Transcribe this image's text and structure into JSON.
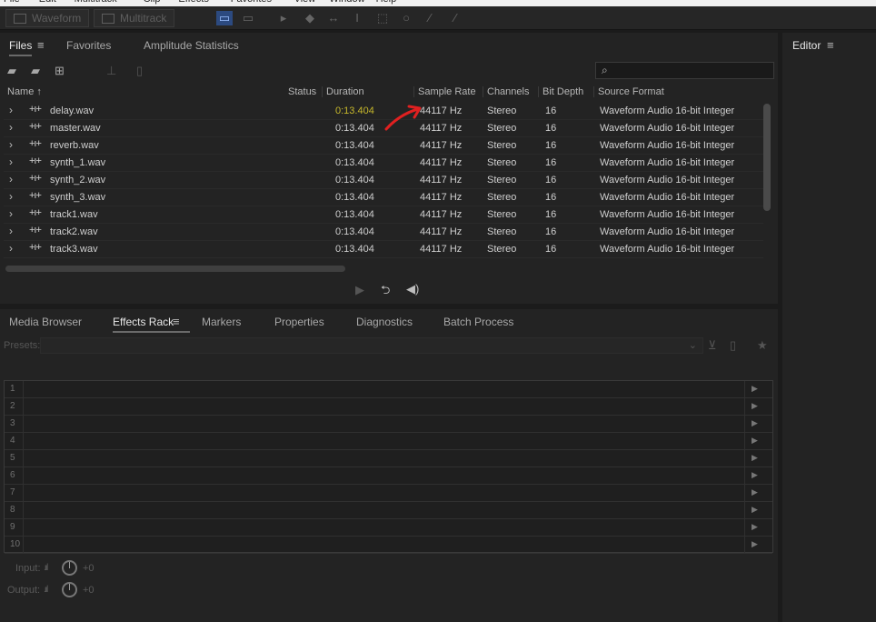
{
  "menu": [
    "File",
    "Edit",
    "Multitrack",
    "Clip",
    "Effects",
    "Favorites",
    "View",
    "Window",
    "Help"
  ],
  "toolbar": {
    "waveform_label": "Waveform",
    "multitrack_label": "Multitrack"
  },
  "files_panel": {
    "tabs": [
      {
        "label": "Files"
      },
      {
        "label": "Favorites"
      },
      {
        "label": "Amplitude Statistics"
      }
    ],
    "search_placeholder": "",
    "columns": [
      "Name",
      "Status",
      "Duration",
      "Sample Rate",
      "Channels",
      "Bit Depth",
      "Source Format"
    ],
    "rows": [
      {
        "name": "delay.wav",
        "status": "",
        "duration": "0:13.404",
        "sample_rate": "44117 Hz",
        "channels": "Stereo",
        "bit_depth": "16",
        "source_format": "Waveform Audio 16-bit Integer"
      },
      {
        "name": "master.wav",
        "status": "",
        "duration": "0:13.404",
        "sample_rate": "44117 Hz",
        "channels": "Stereo",
        "bit_depth": "16",
        "source_format": "Waveform Audio 16-bit Integer"
      },
      {
        "name": "reverb.wav",
        "status": "",
        "duration": "0:13.404",
        "sample_rate": "44117 Hz",
        "channels": "Stereo",
        "bit_depth": "16",
        "source_format": "Waveform Audio 16-bit Integer"
      },
      {
        "name": "synth_1.wav",
        "status": "",
        "duration": "0:13.404",
        "sample_rate": "44117 Hz",
        "channels": "Stereo",
        "bit_depth": "16",
        "source_format": "Waveform Audio 16-bit Integer"
      },
      {
        "name": "synth_2.wav",
        "status": "",
        "duration": "0:13.404",
        "sample_rate": "44117 Hz",
        "channels": "Stereo",
        "bit_depth": "16",
        "source_format": "Waveform Audio 16-bit Integer"
      },
      {
        "name": "synth_3.wav",
        "status": "",
        "duration": "0:13.404",
        "sample_rate": "44117 Hz",
        "channels": "Stereo",
        "bit_depth": "16",
        "source_format": "Waveform Audio 16-bit Integer"
      },
      {
        "name": "track1.wav",
        "status": "",
        "duration": "0:13.404",
        "sample_rate": "44117 Hz",
        "channels": "Stereo",
        "bit_depth": "16",
        "source_format": "Waveform Audio 16-bit Integer"
      },
      {
        "name": "track2.wav",
        "status": "",
        "duration": "0:13.404",
        "sample_rate": "44117 Hz",
        "channels": "Stereo",
        "bit_depth": "16",
        "source_format": "Waveform Audio 16-bit Integer"
      },
      {
        "name": "track3.wav",
        "status": "",
        "duration": "0:13.404",
        "sample_rate": "44117 Hz",
        "channels": "Stereo",
        "bit_depth": "16",
        "source_format": "Waveform Audio 16-bit Integer"
      }
    ]
  },
  "editor_panel": {
    "title": "Editor"
  },
  "effects_panel": {
    "tabs": [
      {
        "label": "Media Browser"
      },
      {
        "label": "Effects Rack"
      },
      {
        "label": "Markers"
      },
      {
        "label": "Properties"
      },
      {
        "label": "Diagnostics"
      },
      {
        "label": "Batch Process"
      }
    ],
    "presets_label": "Presets:",
    "slots": [
      "1",
      "2",
      "3",
      "4",
      "5",
      "6",
      "7",
      "8",
      "9",
      "10"
    ],
    "input_label": "Input:",
    "input_value": "+0",
    "output_label": "Output:",
    "output_value": "+0"
  },
  "colors": {
    "accent": "#2c4a80",
    "duration_highlight": "#c7b82b",
    "annotation_arrow": "#e02020"
  },
  "icons": [
    "folder-open-icon",
    "import-icon",
    "new-file-icon",
    "insert-icon",
    "delete-icon",
    "search-icon",
    "play-icon",
    "loop-icon",
    "volume-icon",
    "waveform-icon",
    "chevron-right-icon",
    "save-preset-icon",
    "favorite-star-icon",
    "knob-icon"
  ]
}
